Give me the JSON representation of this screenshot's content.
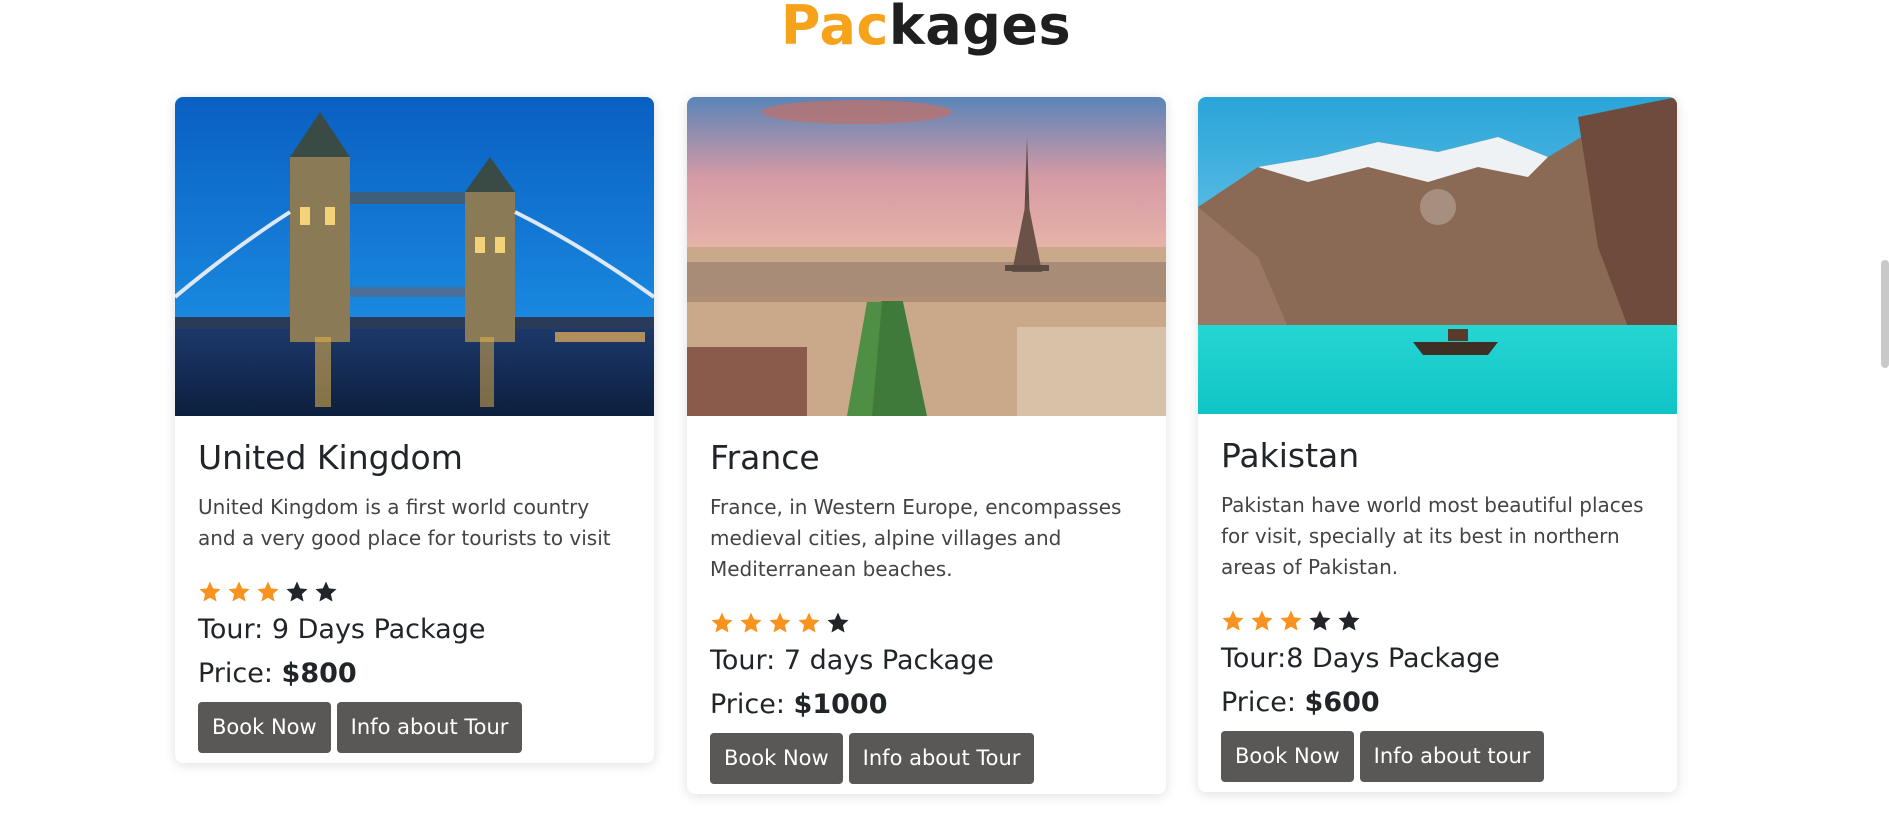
{
  "section": {
    "heading_accent": "Pac",
    "heading_rest": "kages"
  },
  "packages": [
    {
      "title": "United Kingdom",
      "description": "United Kingdom is a first world country and a very good place for tourists to visit",
      "rating": 3,
      "rating_max": 5,
      "tour": "Tour: 9 Days Package",
      "price_label": "Price: ",
      "price": "$800",
      "book_label": "Book Now",
      "info_label": "Info about Tour"
    },
    {
      "title": "France",
      "description": "France, in Western Europe, encompasses medieval cities, alpine villages and Mediterranean beaches.",
      "rating": 4,
      "rating_max": 5,
      "tour": "Tour: 7 days Package",
      "price_label": "Price: ",
      "price": "$1000",
      "book_label": "Book Now",
      "info_label": "Info about Tour"
    },
    {
      "title": "Pakistan",
      "description": "Pakistan have world most beautiful places for visit, specially at its best in northern areas of Pakistan.",
      "rating": 3,
      "rating_max": 5,
      "tour": "Tour:8 Days Package",
      "price_label": "Price: ",
      "price": "$600",
      "book_label": "Book Now",
      "info_label": "Info about tour"
    }
  ],
  "colors": {
    "accent": "#f7a21b",
    "star_on": "#f7931e",
    "star_off": "#212529",
    "button": "#5a5856"
  }
}
